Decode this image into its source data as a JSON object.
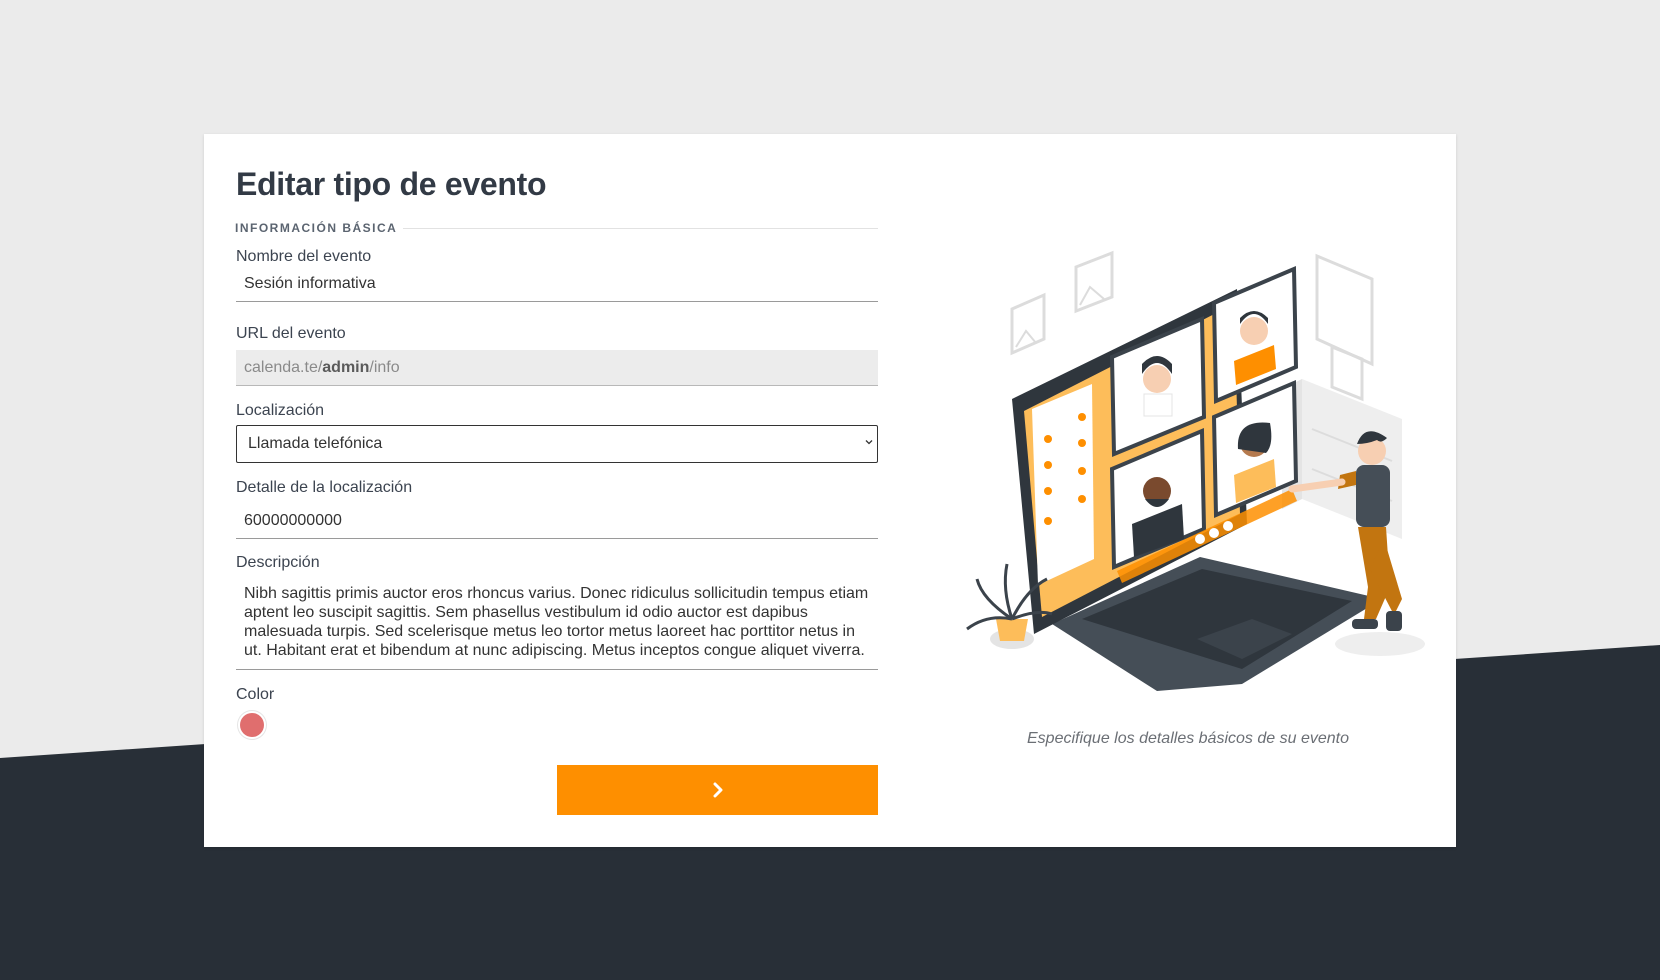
{
  "page": {
    "title": "Editar tipo de evento",
    "section": "INFORMACIÓN BÁSICA"
  },
  "form": {
    "name": {
      "label": "Nombre del evento",
      "value": "Sesión informativa"
    },
    "url": {
      "label": "URL del evento",
      "prefix": "calenda.te/",
      "user": "admin",
      "suffix": "/info"
    },
    "location": {
      "label": "Localización",
      "value": "Llamada telefónica"
    },
    "location_detail": {
      "label": "Detalle de la localización",
      "value": "60000000000"
    },
    "description": {
      "label": "Descripción",
      "value": "Nibh sagittis primis auctor eros rhoncus varius. Donec ridiculus sollicitudin tempus etiam aptent leo suscipit sagittis. Sem phasellus vestibulum id odio auctor est dapibus malesuada turpis. Sed scelerisque metus leo tortor metus laoreet hac porttitor netus in ut. Habitant erat et bibendum at nunc adipiscing. Metus inceptos congue aliquet viverra."
    },
    "color": {
      "label": "Color",
      "value": "#e06e6e"
    }
  },
  "next_button": {
    "icon": "chevron-right-icon"
  },
  "illustration": {
    "caption": "Especifique los detalles básicos de su evento",
    "name": "video-call-illustration"
  },
  "colors": {
    "accent": "#fe8f00",
    "dark_background": "#282f37",
    "light_background": "#ebebeb"
  }
}
